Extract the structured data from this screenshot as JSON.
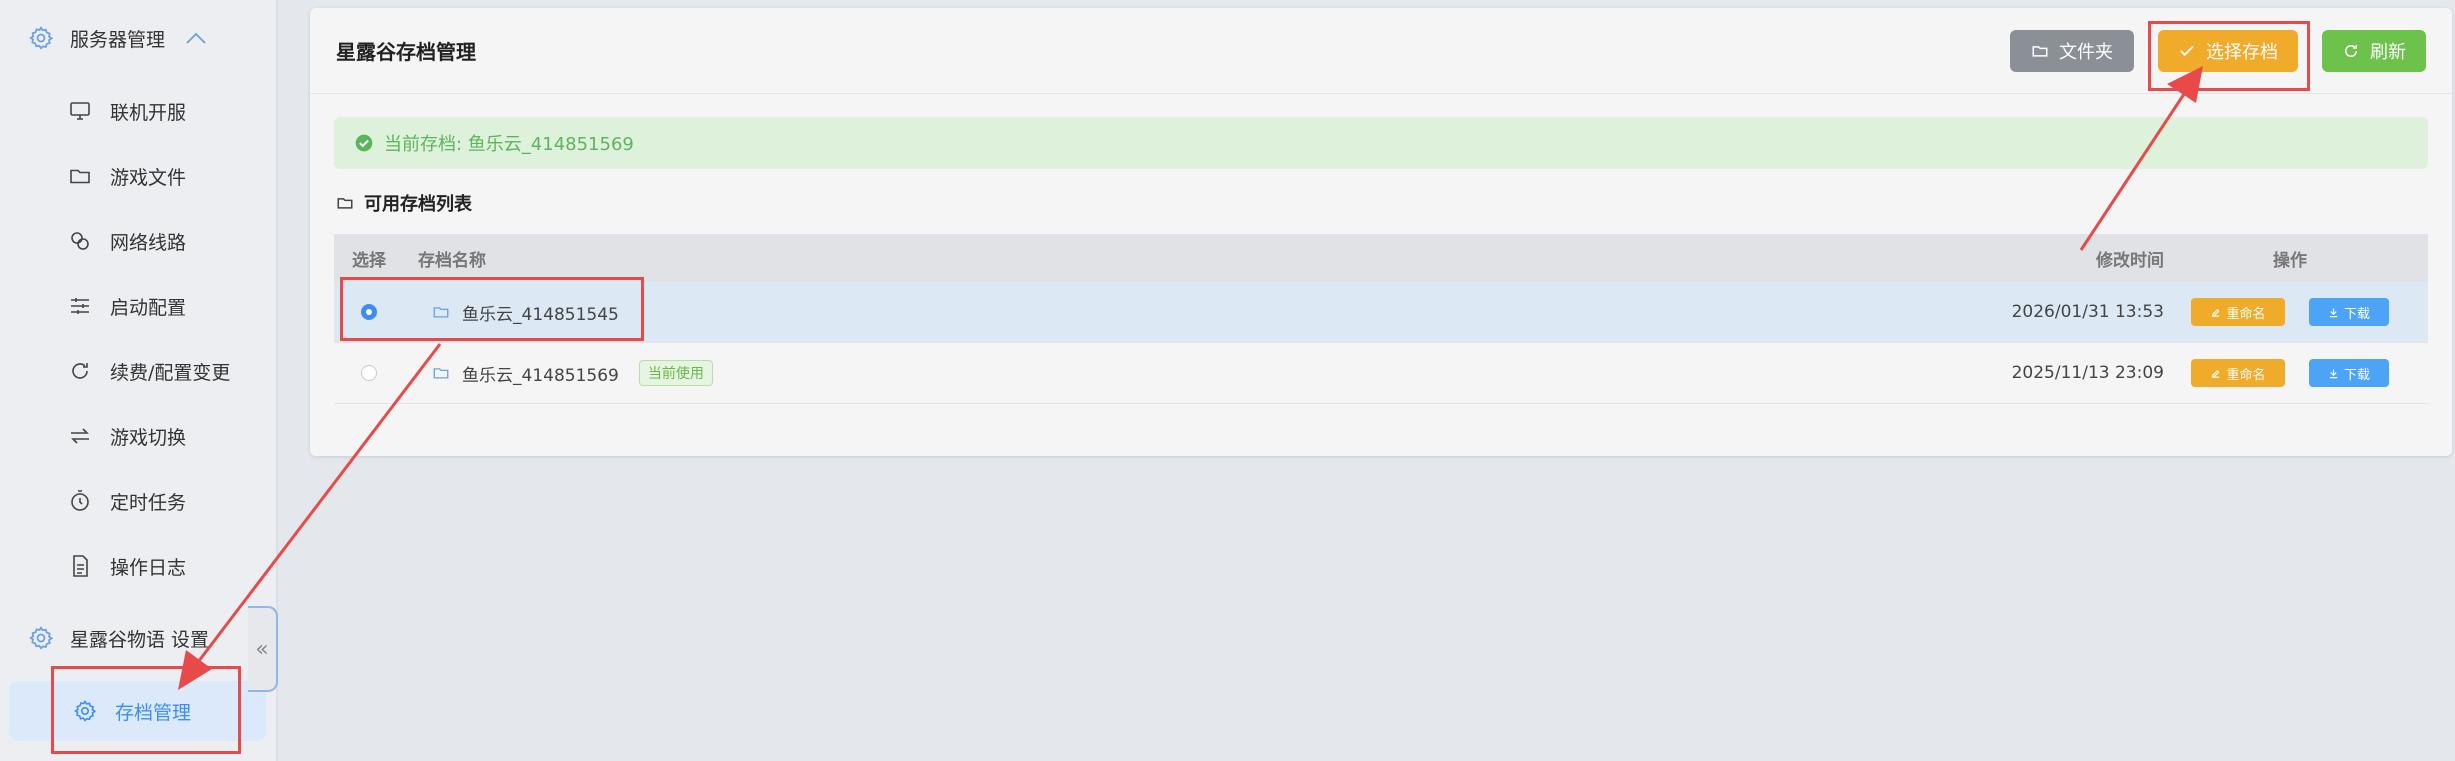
{
  "sidebar": {
    "group_server": "服务器管理",
    "items": [
      {
        "label": "联机开服",
        "icon": "monitor-icon"
      },
      {
        "label": "游戏文件",
        "icon": "folder-icon"
      },
      {
        "label": "网络线路",
        "icon": "network-icon"
      },
      {
        "label": "启动配置",
        "icon": "sliders-icon"
      },
      {
        "label": "续费/配置变更",
        "icon": "refresh-icon"
      },
      {
        "label": "游戏切换",
        "icon": "switch-icon"
      },
      {
        "label": "定时任务",
        "icon": "timer-icon"
      },
      {
        "label": "操作日志",
        "icon": "document-icon"
      }
    ],
    "group_game": "星露谷物语 设置",
    "active_item": "存档管理",
    "collapse_glyph": "«"
  },
  "card": {
    "title": "星露谷存档管理",
    "buttons": {
      "folder": "文件夹",
      "select": "选择存档",
      "refresh": "刷新"
    },
    "alert": "当前存档: 鱼乐云_414851569",
    "section_title": "可用存档列表",
    "table": {
      "headers": {
        "select": "选择",
        "name": "存档名称",
        "time": "修改时间",
        "ops": "操作"
      },
      "rows": [
        {
          "name": "鱼乐云_414851545",
          "time": "2026/01/31 13:53",
          "selected": true,
          "tag": ""
        },
        {
          "name": "鱼乐云_414851569",
          "time": "2025/11/13 23:09",
          "selected": false,
          "tag": "当前使用"
        }
      ],
      "rename_label": "重命名",
      "download_label": "下载"
    }
  },
  "colors": {
    "accent": "#3d8ef0",
    "warning": "#f0ab2a",
    "success": "#6cc24a",
    "annotation": "#e84a4a"
  }
}
